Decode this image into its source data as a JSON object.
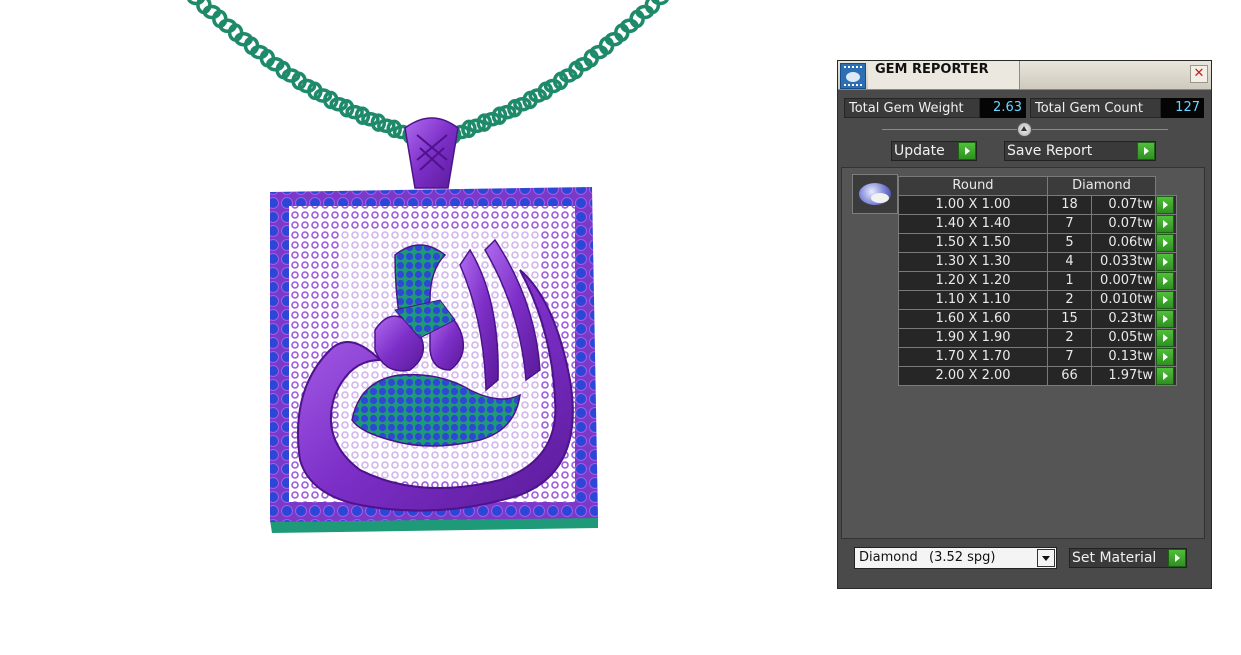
{
  "viewport": {
    "subject": "pendant",
    "colors": {
      "metal": "#8a3fd1",
      "stones": "#2a4fd6",
      "chain": "#1f8a6a"
    }
  },
  "gem_reporter": {
    "title": "GEM REPORTER",
    "total_gem_weight_label": "Total Gem Weight",
    "total_gem_weight_value": "2.63",
    "total_gem_count_label": "Total Gem Count",
    "total_gem_count_value": "127",
    "update_label": "Update",
    "save_report_label": "Save Report",
    "table": {
      "header_shape": "Round",
      "header_material": "Diamond",
      "rows": [
        {
          "size": "1.00 X 1.00",
          "count": "18",
          "weight": "0.07tw"
        },
        {
          "size": "1.40 X 1.40",
          "count": "7",
          "weight": "0.07tw"
        },
        {
          "size": "1.50 X 1.50",
          "count": "5",
          "weight": "0.06tw"
        },
        {
          "size": "1.30 X 1.30",
          "count": "4",
          "weight": "0.033tw"
        },
        {
          "size": "1.20 X 1.20",
          "count": "1",
          "weight": "0.007tw"
        },
        {
          "size": "1.10 X 1.10",
          "count": "2",
          "weight": "0.010tw"
        },
        {
          "size": "1.60 X 1.60",
          "count": "15",
          "weight": "0.23tw"
        },
        {
          "size": "1.90 X 1.90",
          "count": "2",
          "weight": "0.05tw"
        },
        {
          "size": "1.70 X 1.70",
          "count": "7",
          "weight": "0.13tw"
        },
        {
          "size": "2.00 X 2.00",
          "count": "66",
          "weight": "1.97tw"
        }
      ]
    },
    "material_value": "Diamond",
    "material_spg": "(3.52 spg)",
    "set_material_label": "Set Material",
    "colors": {
      "panel_bg": "#4a4a4a",
      "value_text": "#6ad6ff",
      "arrow_button": "#3aa52a"
    }
  }
}
